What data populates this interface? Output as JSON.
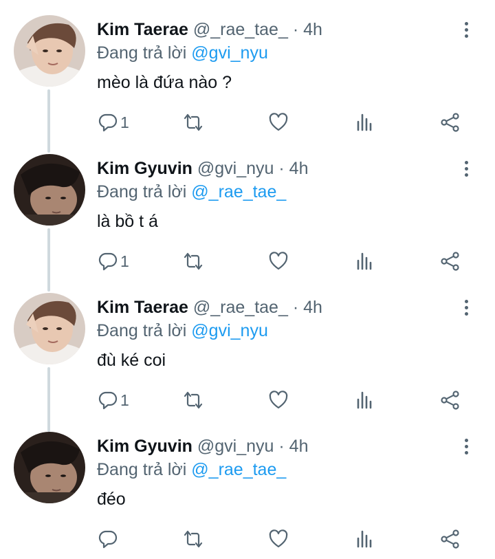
{
  "colors": {
    "accent": "#1d9bf0",
    "muted": "#536471",
    "text": "#0f1419",
    "thread_line": "#cfd9de"
  },
  "tweets": [
    {
      "name": "Kim Taerae",
      "handle": "@_rae_tae_",
      "dot": "·",
      "time": "4h",
      "reply_prefix": "Đang trả lời",
      "reply_to": "@gvi_nyu",
      "text": "mèo là đứa nào ?",
      "reply_count": "1"
    },
    {
      "name": "Kim Gyuvin",
      "handle": "@gvi_nyu",
      "dot": "·",
      "time": "4h",
      "reply_prefix": "Đang trả lời",
      "reply_to": "@_rae_tae_",
      "text": "là bồ t á",
      "reply_count": "1"
    },
    {
      "name": "Kim Taerae",
      "handle": "@_rae_tae_",
      "dot": "·",
      "time": "4h",
      "reply_prefix": "Đang trả lời",
      "reply_to": "@gvi_nyu",
      "text": "đù ké coi",
      "reply_count": "1"
    },
    {
      "name": "Kim Gyuvin",
      "handle": "@gvi_nyu",
      "dot": "·",
      "time": "4h",
      "reply_prefix": "Đang trả lời",
      "reply_to": "@_rae_tae_",
      "text": "đéo",
      "reply_count": ""
    }
  ],
  "icons": {
    "reply": "reply-icon",
    "retweet": "retweet-icon",
    "like": "heart-icon",
    "views": "bar-chart-icon",
    "share": "share-icon",
    "more": "more-vertical-icon"
  }
}
